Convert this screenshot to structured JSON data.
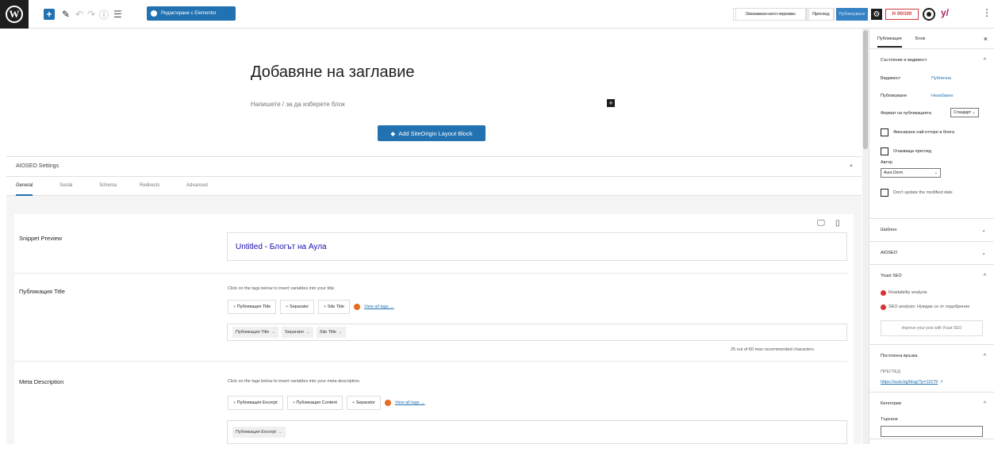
{
  "toolbar": {
    "logo": "W",
    "add": "+",
    "edit_icon": "✎",
    "undo_icon": "↶",
    "redo_icon": "↷",
    "info_icon": "ⓘ",
    "list_icon": "☰",
    "elementor_label": "Редактиране с Elementor",
    "save_draft": "Запазване като чернова",
    "preview": "Преглед",
    "publish": "Публикуване",
    "settings_icon": "⚙",
    "red_badge_icon": "H",
    "red_badge": "00/100",
    "yoast_label": "y/",
    "more_icon": "⋮"
  },
  "editor": {
    "title_placeholder": "Добавяне на заглавие",
    "block_placeholder": "Напишете / за да изберете блок",
    "block_plus": "+",
    "siteorigin_button": "Add SiteOrigin Layout Block"
  },
  "aioseo": {
    "header": "AIOSEO Settings",
    "tabs": [
      "General",
      "Social",
      "Schema",
      "Redirects",
      "Advanced"
    ],
    "snippet_label": "Snippet Preview",
    "snippet_title": "Untitled - Блогът на Аула",
    "title_label": "Публикация Title",
    "title_hint": "Click on the tags below to insert variables into your title.",
    "title_tags": [
      "Публикация Title",
      "Separator",
      "Site Title"
    ],
    "view_all": "View all tags →",
    "title_tokens": [
      "Публикация Title",
      "Separator",
      "Site Title"
    ],
    "title_count": "25 out of 60 max recommended characters.",
    "meta_label": "Meta Description",
    "meta_hint": "Click on the tags below to insert variables into your meta description.",
    "meta_tags": [
      "Публикация Excerpt",
      "Публикация Content",
      "Separator"
    ],
    "meta_tokens": [
      "Публикация Excerpt"
    ],
    "desktop_icon": "🖵",
    "mobile_icon": "▯"
  },
  "sidebar": {
    "tab_post": "Публикация",
    "tab_block": "Блок",
    "close": "×",
    "status_header": "Състояние и видимост",
    "visibility_label": "Видимост",
    "visibility_value": "Публична",
    "publish_label": "Публикуване",
    "publish_value": "Незабавно",
    "format_label": "Формат на публикацията",
    "format_value": "Стандарт",
    "sticky_label": "Фиксиране най-отгоре в блога",
    "pending_label": "Очакваща преглед",
    "author_label": "Автор",
    "author_value": "Aura Dorm",
    "dont_update_label": "Don't update the modified date",
    "template_header": "Шаблон",
    "aioseo_header": "AIOSEO",
    "yoast_header": "Yoast SEO",
    "readability": "Readability analysis",
    "seo_analysis": "SEO analysis: Нуждае се от подобрение",
    "yoast_button": "Improve your post with Yoast SEO",
    "permalink_header": "Постоянна връзка",
    "permalink_label": "ПРЕГЛЕД",
    "permalink_url": "https://aula.bg/blog/?p=11579",
    "categories_header": "Категории",
    "categories_search": "Търсене"
  }
}
